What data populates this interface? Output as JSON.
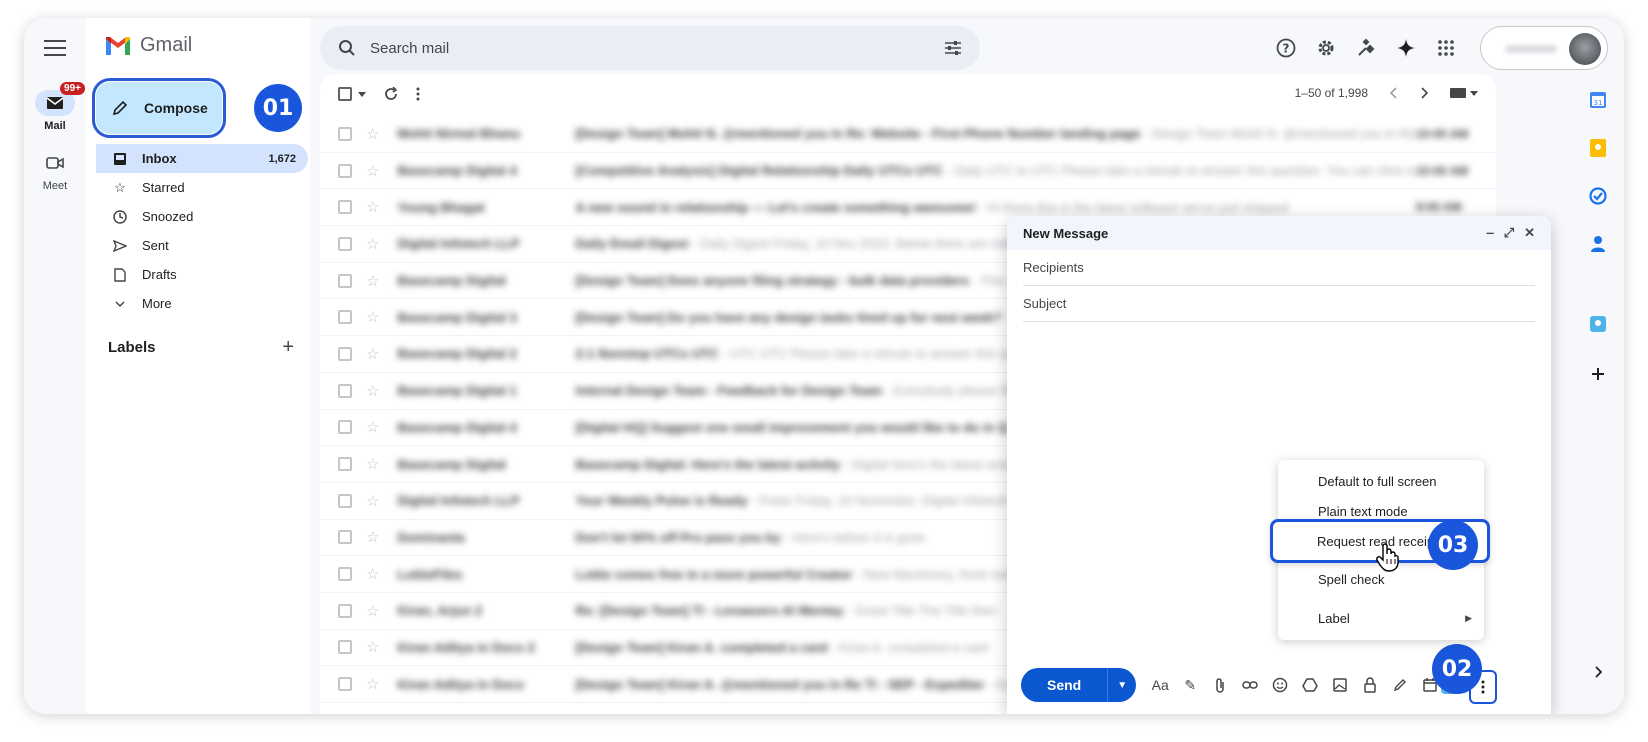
{
  "app": {
    "logo_text": "Gmail"
  },
  "rail": {
    "items": [
      {
        "label": "Mail",
        "badge": "99+"
      },
      {
        "label": "Meet"
      }
    ]
  },
  "sidebar": {
    "compose_label": "Compose",
    "nav": [
      {
        "label": "Inbox",
        "count": "1,672"
      },
      {
        "label": "Starred"
      },
      {
        "label": "Snoozed"
      },
      {
        "label": "Sent"
      },
      {
        "label": "Drafts"
      },
      {
        "label": "More"
      }
    ],
    "labels_heading": "Labels",
    "labels_add": "+"
  },
  "search": {
    "placeholder": "Search mail"
  },
  "toolbar": {
    "range": "1–50 of 1,998"
  },
  "markers": {
    "m1": "01",
    "m2": "02",
    "m3": "03"
  },
  "composer": {
    "title": "New Message",
    "recipients_placeholder": "Recipients",
    "subject_placeholder": "Subject",
    "send_label": "Send"
  },
  "menu": {
    "items": [
      "Default to full screen",
      "Plain text mode",
      "Request read receipt",
      "Spell check",
      "Label"
    ]
  },
  "colors": {
    "accent": "#1a56db",
    "compose_bg": "#c2e7ff",
    "send": "#0b57d0",
    "badge": "#c5221f"
  }
}
